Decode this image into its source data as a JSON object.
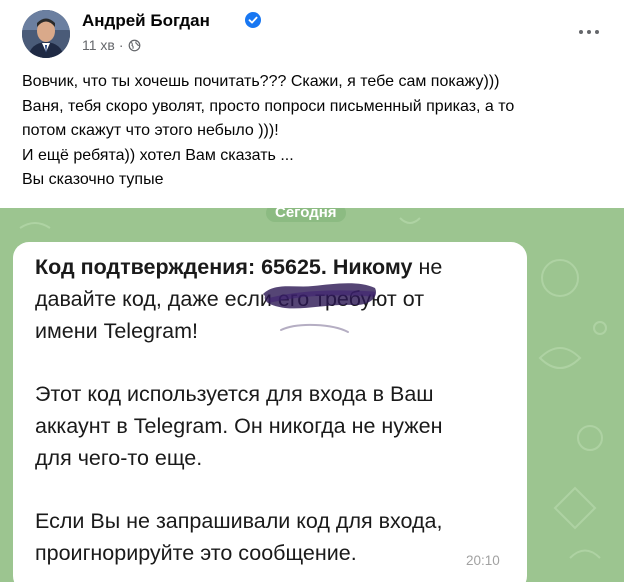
{
  "post": {
    "author": "Андрей Богдан",
    "time": "11 хв",
    "separator": "·",
    "verified": "verified-badge-icon",
    "audience": "globe-icon",
    "menu": "more-options-icon",
    "text_lines": [
      "Вовчик, что ты хочешь почитать??? Скажи, я тебе сам покажу)))",
      "Ваня, тебя скоро уволят, просто попроси письменный приказ, а то",
      "потом скажут что этого небыло )))!",
      "И ещё ребята)) хотел Вам сказать ...",
      "Вы сказочно тупые"
    ]
  },
  "screenshot": {
    "date_pill": "Сегодня",
    "message": {
      "bold_lead": "Код подтверждения: ",
      "code": "65625",
      "bold_after_code": ". Никому",
      "after_bold": " не",
      "line2": "давайте код, даже если его требуют от",
      "line3": "имени Telegram!",
      "line4": "Этот код используется для входа в Ваш",
      "line5": "аккаунт в Telegram. Он никогда не нужен",
      "line6": "для чего-то еще.",
      "line7": "Если Вы не запрашивали код для входа,",
      "line8": "проигнорируйте это сообщение."
    },
    "time": "20:10"
  },
  "colors": {
    "verified_blue": "#1877f2",
    "secondary_text": "#65676b",
    "chat_background": "#9cc590",
    "scribble": "#2b1752"
  }
}
